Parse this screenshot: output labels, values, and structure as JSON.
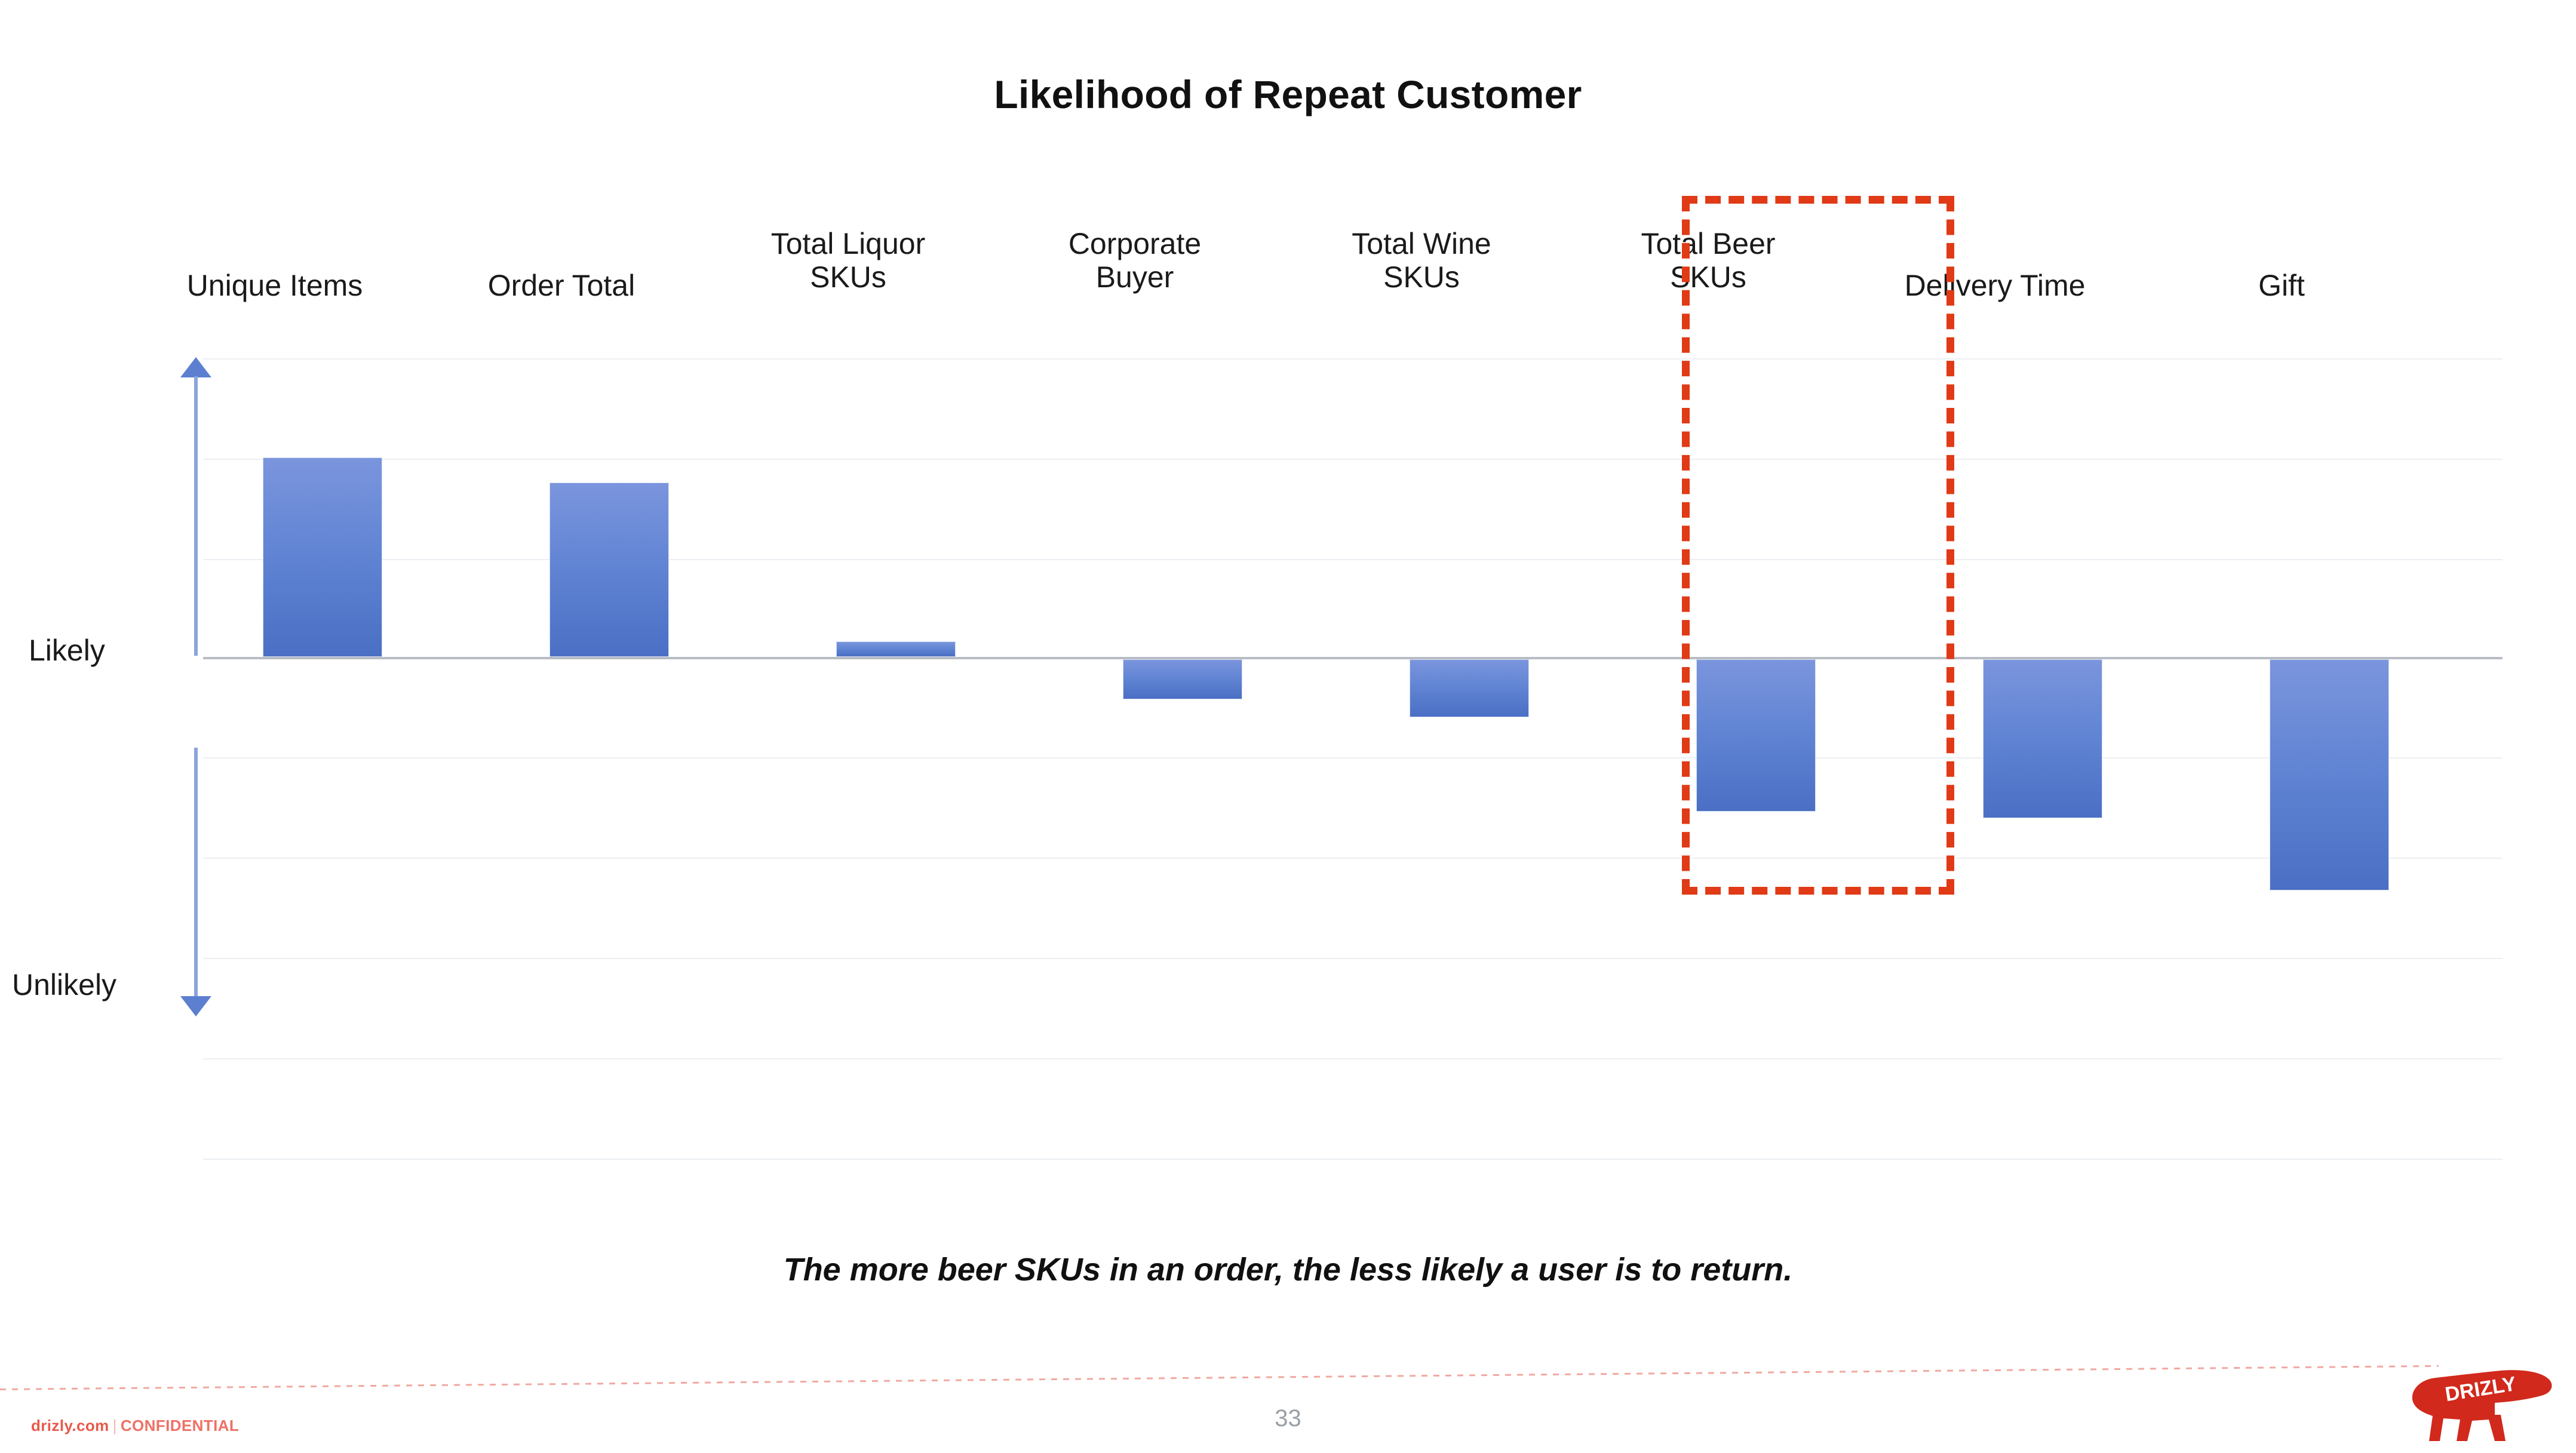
{
  "slide": {
    "title": "Likelihood of Repeat Customer",
    "caption": "The more beer SKUs in an order, the less likely a user is to return.",
    "page_number": "33"
  },
  "footer": {
    "site": "drizly.com",
    "separator": "|",
    "classification": "CONFIDENTIAL",
    "logo_text": "DRIZLY",
    "logo_icon": "bear-logo-icon"
  },
  "axis": {
    "positive_label": "Likely",
    "negative_label": "Unlikely",
    "up_arrow_icon": "arrow-up-icon",
    "down_arrow_icon": "arrow-down-icon"
  },
  "highlight": {
    "target": "Total Beer SKUs",
    "color": "#e03a16",
    "style": "dashed"
  },
  "colors": {
    "bar_top": "#7b95dd",
    "bar_bottom": "#4a6fc4",
    "axis_line": "#b8bcc4",
    "gridline": "#eceff3",
    "arrow": "#8ba4dd",
    "highlight": "#e03a16",
    "brand_red": "#e8594a"
  },
  "chart_data": {
    "type": "bar",
    "title": "Likelihood of Repeat Customer",
    "xlabel": "",
    "ylabel": "Likelihood of Repeat Customer",
    "ylim": [
      -3.0,
      2.5
    ],
    "grid": true,
    "legend": null,
    "ytick_labels": [
      "Likely",
      "Unlikely"
    ],
    "annotations": [
      "The more beer SKUs in an order, the less likely a user is to return."
    ],
    "categories": [
      "Unique Items",
      "Order Total",
      "Total Liquor SKUs",
      "Corporate Buyer",
      "Total Wine SKUs",
      "Total Beer SKUs",
      "Delivery Time",
      "Gift"
    ],
    "values": [
      2.36,
      2.06,
      0.18,
      -0.47,
      -0.68,
      -1.8,
      -1.88,
      -2.73
    ],
    "bars": [
      {
        "label": "Unique Items",
        "label_lines": [
          "Unique Items"
        ],
        "value": 2.36,
        "direction": "positive",
        "highlighted": false
      },
      {
        "label": "Order Total",
        "label_lines": [
          "Order Total"
        ],
        "value": 2.06,
        "direction": "positive",
        "highlighted": false
      },
      {
        "label": "Total Liquor SKUs",
        "label_lines": [
          "Total Liquor",
          "SKUs"
        ],
        "value": 0.18,
        "direction": "positive",
        "highlighted": false
      },
      {
        "label": "Corporate Buyer",
        "label_lines": [
          "Corporate",
          "Buyer"
        ],
        "value": -0.47,
        "direction": "negative",
        "highlighted": false
      },
      {
        "label": "Total Wine SKUs",
        "label_lines": [
          "Total Wine",
          "SKUs"
        ],
        "value": -0.68,
        "direction": "negative",
        "highlighted": false
      },
      {
        "label": "Total Beer SKUs",
        "label_lines": [
          "Total Beer",
          "SKUs"
        ],
        "value": -1.8,
        "direction": "negative",
        "highlighted": true
      },
      {
        "label": "Delivery Time",
        "label_lines": [
          "Delivery Time"
        ],
        "value": -1.88,
        "direction": "negative",
        "highlighted": false
      },
      {
        "label": "Gift",
        "label_lines": [
          "Gift"
        ],
        "value": -2.73,
        "direction": "negative",
        "highlighted": false
      }
    ]
  }
}
